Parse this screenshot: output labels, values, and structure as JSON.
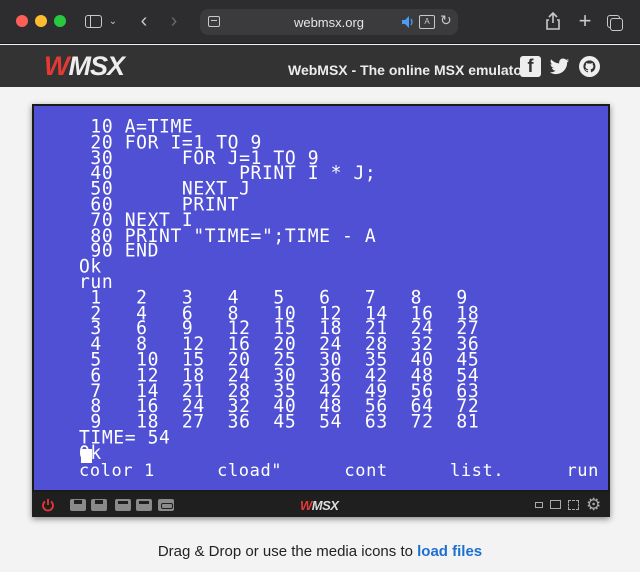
{
  "browser": {
    "url": "webmsx.org",
    "icons": [
      "sidebar-icon",
      "chevron-down-icon",
      "back-icon",
      "forward-icon",
      "page-icon",
      "speaker-icon",
      "translate-icon",
      "reload-icon",
      "share-icon",
      "plus-icon",
      "tabs-icon"
    ]
  },
  "header": {
    "logo_prefix": "W",
    "logo_rest": "MSX",
    "title": "WebMSX - The online MSX emulator",
    "social": [
      "facebook-icon",
      "twitter-icon",
      "github-icon"
    ]
  },
  "screen": {
    "text": " 10 A=TIME\n 20 FOR I=1 TO 9\n 30      FOR J=1 TO 9\n 40           PRINT I * J;\n 50      NEXT J\n 60      PRINT\n 70 NEXT I\n 80 PRINT \"TIME=\";TIME - A\n 90 END\nOk\nrun\n 1   2   3   4   5   6   7   8   9\n 2   4   6   8   10  12  14  16  18\n 3   6   9   12  15  18  21  24  27\n 4   8   12  16  20  24  28  32  36\n 5   10  15  20  25  30  35  40  45\n 6   12  18  24  30  36  42  48  54\n 7   14  21  28  35  42  49  56  63\n 8   16  24  32  40  48  56  64  72\n 9   18  27  36  45  54  63  72  81\nTIME= 54\nOk",
    "function_keys": [
      "color 1",
      "cload\"",
      "cont",
      "list.",
      "run"
    ],
    "background": "#5050d4"
  },
  "emulator_bar": {
    "logo_prefix": "W",
    "logo_rest": "MSX",
    "icons": [
      "power-icon",
      "disk-a-icon",
      "disk-b-icon",
      "cartridge-1-icon",
      "cartridge-2-icon",
      "tape-icon",
      "window-small-icon",
      "window-normal-icon",
      "fullscreen-icon",
      "settings-icon"
    ]
  },
  "footer": {
    "hint_text": "Drag & Drop or use the media icons to ",
    "hint_link": "load files"
  },
  "colors": {
    "accent_red": "#e53935",
    "link_blue": "#1d6fd0"
  }
}
